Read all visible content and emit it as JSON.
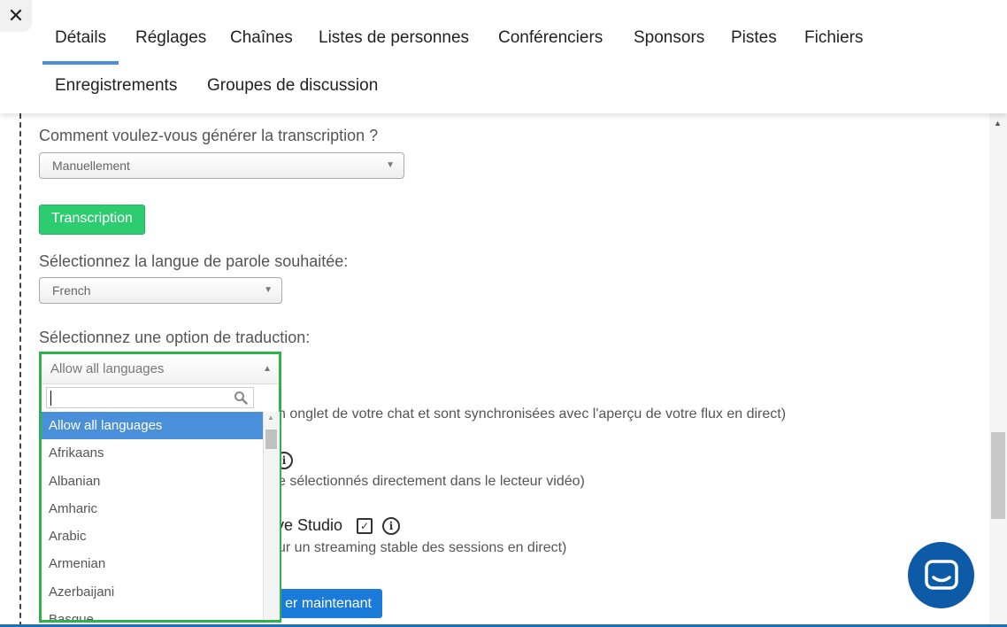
{
  "header": {
    "close_symbol": "✕",
    "tabs": [
      {
        "label": "Détails"
      },
      {
        "label": "Réglages"
      },
      {
        "label": "Chaînes"
      },
      {
        "label": "Listes de personnes"
      },
      {
        "label": "Conférenciers"
      },
      {
        "label": "Sponsors"
      },
      {
        "label": "Pistes"
      },
      {
        "label": "Fichiers"
      },
      {
        "label": "Enregistrements"
      },
      {
        "label": "Groupes de discussion"
      }
    ],
    "active_tab": "Détails"
  },
  "transcription": {
    "question": "Comment voulez-vous générer la transcription ?",
    "method_value": "Manuellement",
    "button_label": "Transcription"
  },
  "language": {
    "question": "Sélectionnez la langue de parole souhaitée:",
    "value": "French"
  },
  "translation": {
    "question": "Sélectionnez une option de traduction:",
    "value": "Allow all languages",
    "options": [
      "Allow all languages",
      "Afrikaans",
      "Albanian",
      "Amharic",
      "Arabic",
      "Armenian",
      "Azerbaijani",
      "Basque"
    ],
    "active_option": "Allow all languages"
  },
  "behind": {
    "text1": "n onglet de votre chat et sont synchronisées avec l'aperçu de votre flux en direct)",
    "text2": "e sélectionnés directement dans le lecteur vidéo)",
    "title3": "ve Studio",
    "text3": "ur un streaming stable des sessions en direct)",
    "button": "er maintenant"
  },
  "colors": {
    "accent": "#4a90d9",
    "green_button": "#2ecc71",
    "highlight_border": "#2db34a",
    "chat_button": "#0d5aa7"
  }
}
